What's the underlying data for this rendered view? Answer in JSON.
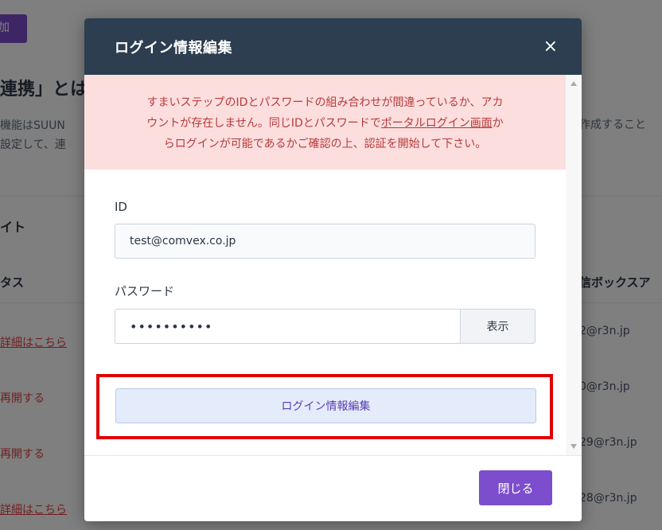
{
  "background": {
    "top_button": "加",
    "heading": "連携」とは",
    "description_lines": [
      "機能はSUUN",
      "設定して、連"
    ],
    "description_right": "作成すること",
    "section_title": "イト",
    "column_status": "タス",
    "column_inbox": "信ボックスア",
    "rows": [
      {
        "status": "詳細はこちら",
        "mail": "2@r3n.jp"
      },
      {
        "status": "再開する",
        "mail": "0@r3n.jp"
      },
      {
        "status": "再開する",
        "mail": "29@r3n.jp"
      },
      {
        "status": "詳細はこちら",
        "mail": "28@r3n.jp"
      }
    ]
  },
  "modal": {
    "title": "ログイン情報編集",
    "close_icon": "×",
    "alert": {
      "line1": "すまいステップのIDとパスワードの組み合わせが間違っているか、アカ",
      "line2_prefix": "ウントが存在しません。同じIDとパスワードで",
      "line2_link": "ポータルログイン画面",
      "line2_suffix": "か",
      "line3": "らログインが可能であるかご確認の上、認証を開始して下さい。"
    },
    "id_label": "ID",
    "id_value": "test@comvex.co.jp",
    "password_label": "パスワード",
    "password_value": "••••••••••",
    "show_button": "表示",
    "submit_button": "ログイン情報編集",
    "close_button": "閉じる"
  },
  "colors": {
    "header_bg": "#2c3e50",
    "alert_bg": "#fcdede",
    "alert_text": "#b83a3a",
    "primary_purple": "#7c4dcc",
    "highlight_red": "#e00000"
  }
}
